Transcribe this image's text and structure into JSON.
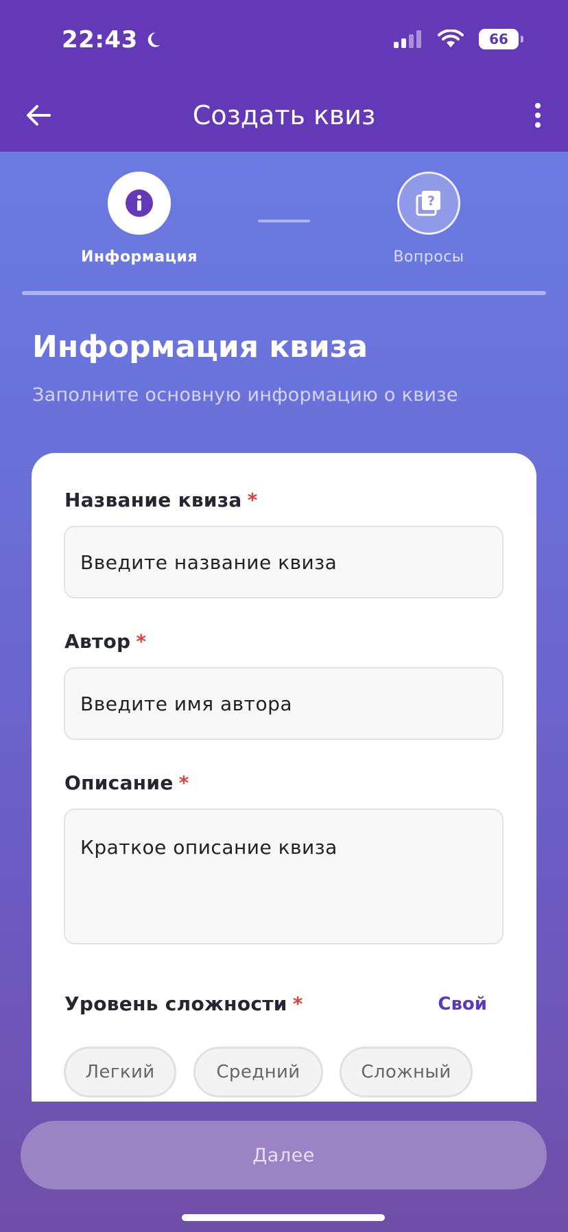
{
  "status_bar": {
    "time": "22:43",
    "battery": "66"
  },
  "nav": {
    "title": "Создать квиз"
  },
  "stepper": {
    "steps": [
      {
        "label": "Информация",
        "active": true
      },
      {
        "label": "Вопросы",
        "active": false
      }
    ]
  },
  "section": {
    "title": "Информация квиза",
    "subtitle": "Заполните основную информацию о квизе"
  },
  "form": {
    "name": {
      "label": "Название квиза",
      "placeholder": "Введите название квиза"
    },
    "author": {
      "label": "Автор",
      "placeholder": "Введите имя автора"
    },
    "description": {
      "label": "Описание",
      "placeholder": "Краткое описание квиза"
    },
    "difficulty": {
      "label": "Уровень сложности",
      "custom_link": "Свой",
      "options": [
        "Легкий",
        "Средний",
        "Сложный"
      ]
    },
    "required_mark": "*"
  },
  "actions": {
    "next_label": "Далее"
  },
  "colors": {
    "header": "#6439b8",
    "accent": "#5a3bb5",
    "required": "#e0413b",
    "button_disabled": "#9a84c4"
  }
}
